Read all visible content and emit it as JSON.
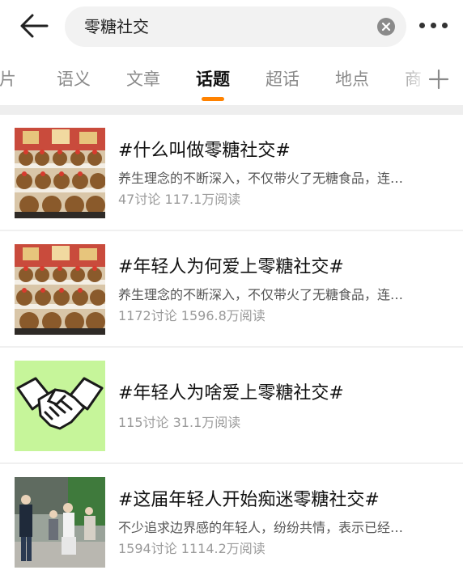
{
  "search": {
    "query": "零糖社交"
  },
  "tabs": [
    {
      "label": "图片"
    },
    {
      "label": "语义"
    },
    {
      "label": "文章"
    },
    {
      "label": "话题"
    },
    {
      "label": "超话"
    },
    {
      "label": "地点"
    },
    {
      "label": "商"
    }
  ],
  "active_tab": "话题",
  "colors": {
    "accent": "#ff8200",
    "title": "#111111",
    "meta": "#9a9a9a"
  },
  "topics": [
    {
      "title": "#什么叫做零糖社交#",
      "desc": "养生理念的不断深入，不仅带火了无糖食品，连…",
      "stats": "47讨论 117.1万阅读",
      "thumb_icon": "plush-toys-photo-icon"
    },
    {
      "title": "#年轻人为何爱上零糖社交#",
      "desc": "养生理念的不断深入，不仅带火了无糖食品，连…",
      "stats": "1172讨论 1596.8万阅读",
      "thumb_icon": "plush-toys-photo-icon"
    },
    {
      "title": "#年轻人为啥爱上零糖社交#",
      "desc": "",
      "stats": "115讨论 31.1万阅读",
      "thumb_icon": "handshake-icon"
    },
    {
      "title": "#这届年轻人开始痴迷零糖社交#",
      "desc": "不少追求边界感的年轻人，纷纷共情，表示已经…",
      "stats": "1594讨论 1114.2万阅读",
      "thumb_icon": "people-photo-icon"
    }
  ]
}
